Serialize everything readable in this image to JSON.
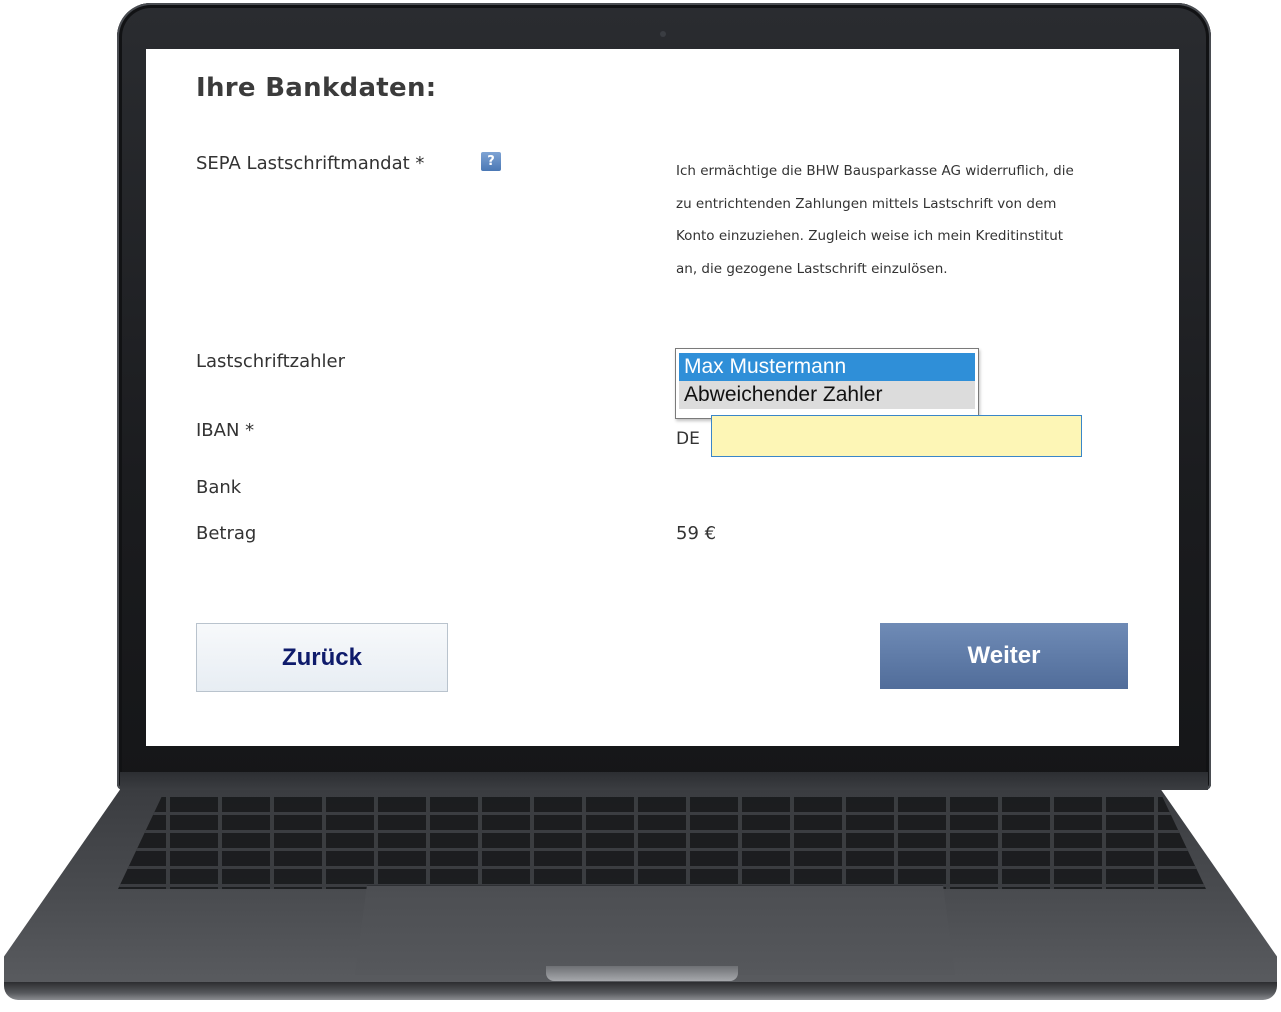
{
  "form": {
    "title": "Ihre Bankdaten:",
    "mandate_label": "SEPA Lastschriftmandat *",
    "help_icon_text": "?",
    "mandate_text": "Ich ermächtige die BHW Bausparkasse AG widerruflich, die zu entrichtenden Zahlungen mittels Lastschrift von dem Konto einzuziehen. Zugleich weise ich mein Kreditinstitut an, die gezogene Lastschrift einzulösen.",
    "payer_label": "Lastschriftzahler",
    "payer_options": [
      "Max Mustermann",
      "Abweichender Zahler"
    ],
    "payer_selected": "Max Mustermann",
    "iban_label": "IBAN *",
    "iban_prefix": "DE",
    "iban_value": "",
    "bank_label": "Bank",
    "amount_label": "Betrag",
    "amount_value": "59 €"
  },
  "buttons": {
    "back_label": "Zurück",
    "next_label": "Weiter"
  },
  "colors": {
    "selected_option": "#2f8fd8",
    "iban_field": "#fdf6b6",
    "next_button": "#5f7ba8",
    "back_button_text": "#0e1b6b"
  }
}
